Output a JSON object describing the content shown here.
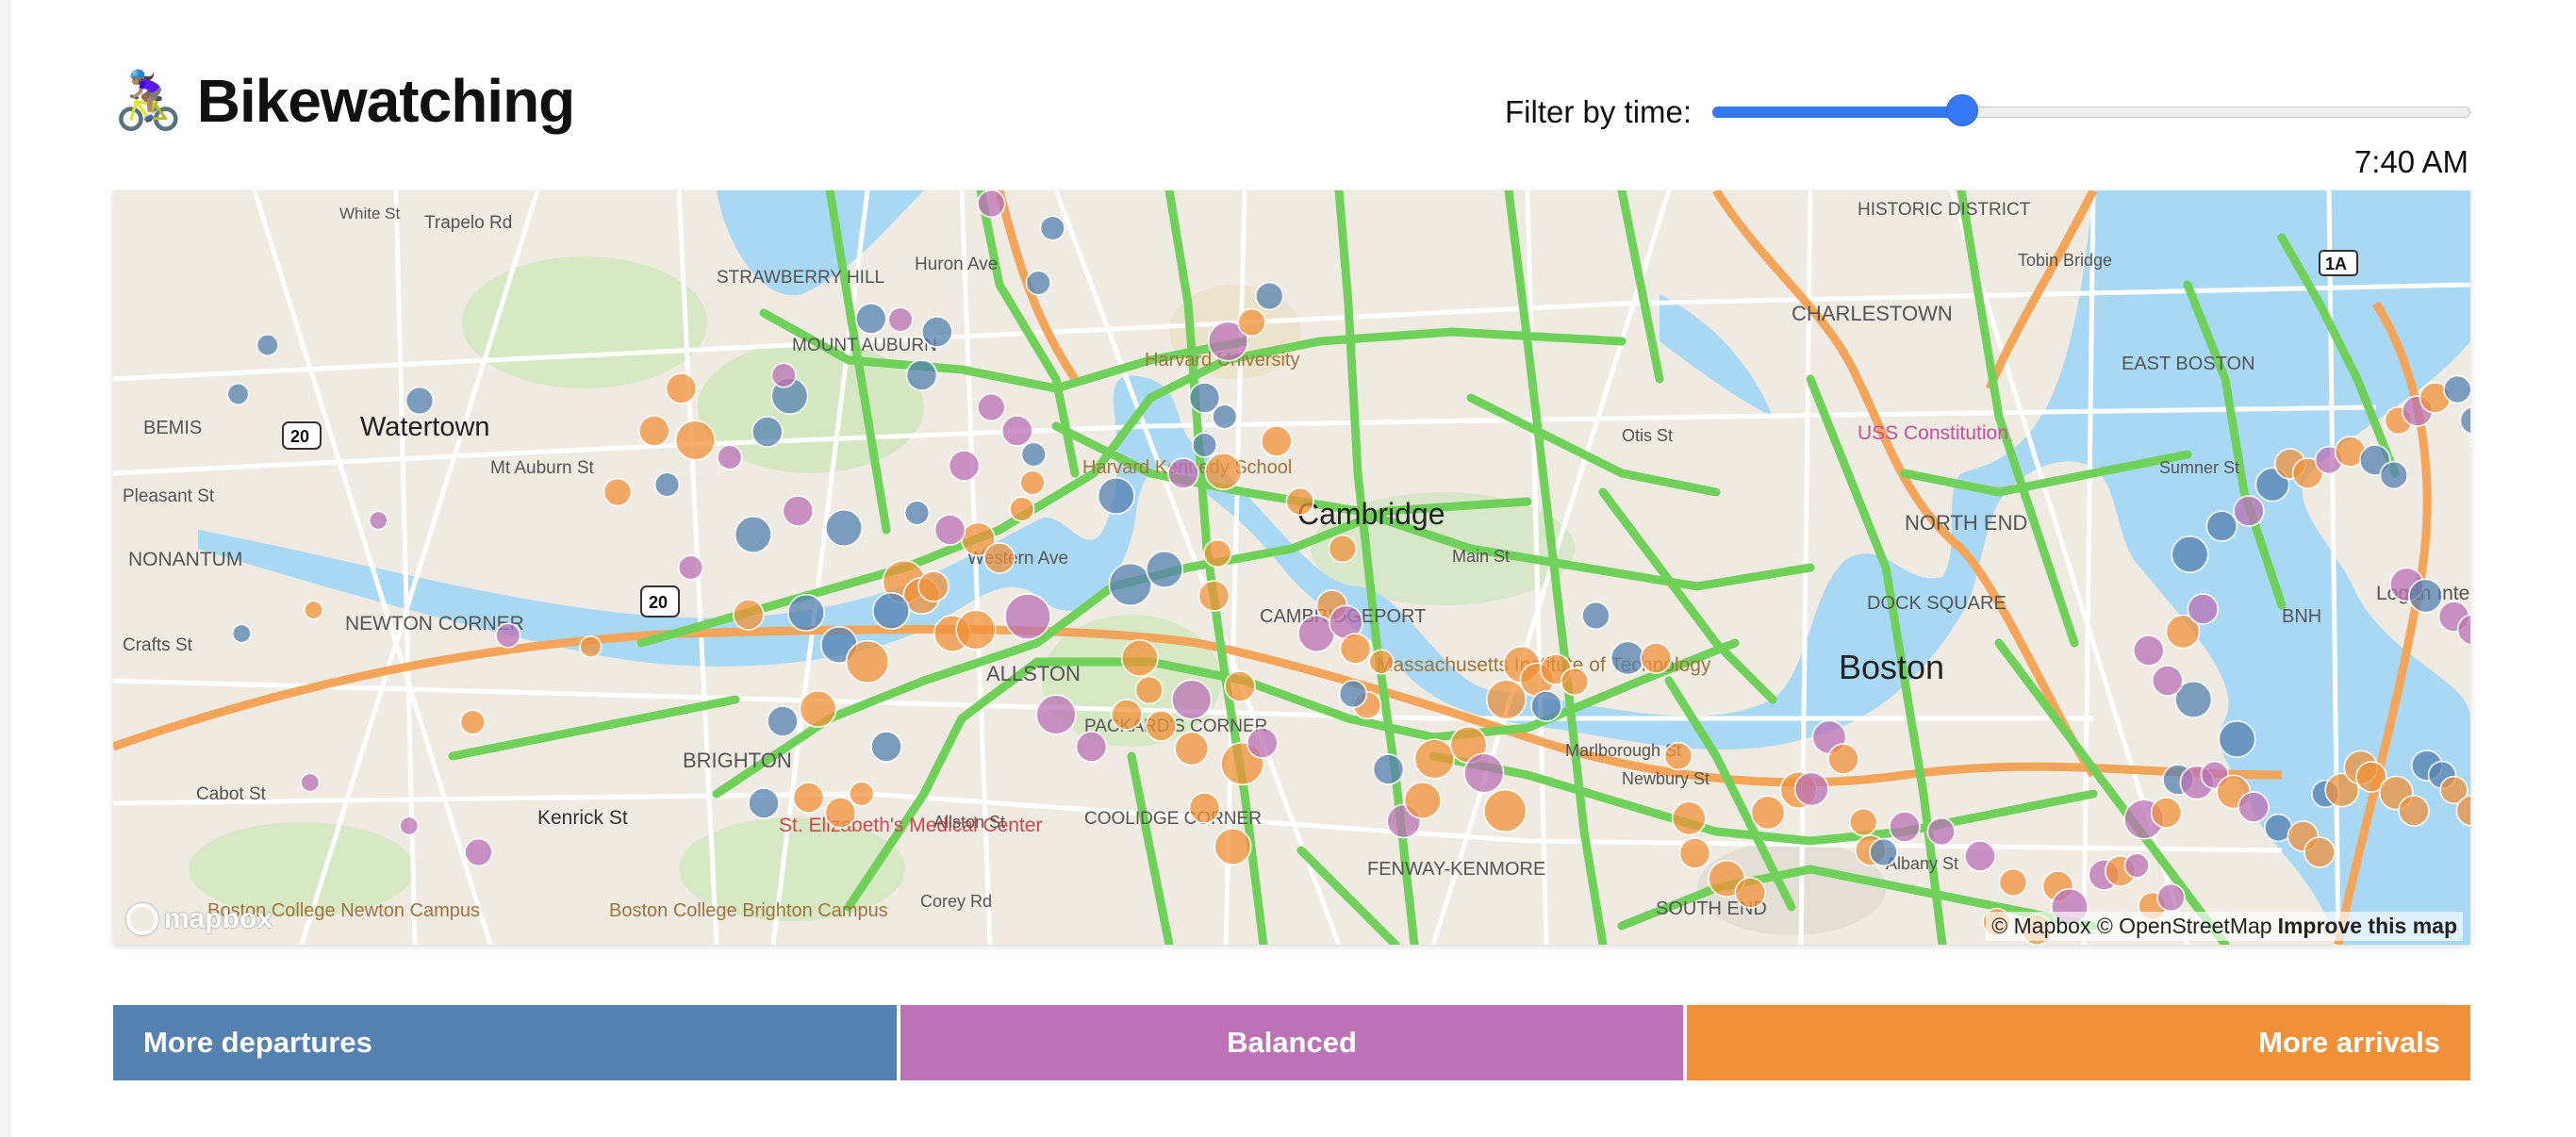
{
  "header": {
    "emoji": "🚴🏽‍♀️",
    "title": "Bikewatching"
  },
  "filter": {
    "label": "Filter by time:",
    "value_fraction": 0.33,
    "time_display": "7:40 AM"
  },
  "colors": {
    "departures": "#5581b0",
    "balanced": "#bb72b6",
    "arrivals": "#f0913a",
    "bike_lanes": "#6fd15a",
    "water": "#a8d8f3",
    "highway": "#f5a55a",
    "slider": "#3478f6"
  },
  "map": {
    "labels": [
      "Watertown",
      "BEMIS",
      "NONANTUM",
      "NEWTON CORNER",
      "Pleasant St",
      "Mt Auburn St",
      "Crafts St",
      "Cabot St",
      "Kenrick St",
      "BRIGHTON",
      "St. Elizabeth's Medical Center",
      "ALLSTON",
      "Western Ave",
      "PACKARD'S CORNER",
      "COOLIDGE CORNER",
      "FENWAY-KENMORE",
      "SOUTH END",
      "Cambridge",
      "CAMBRIDGEPORT",
      "Massachusetts Institute of Technology",
      "Harvard University",
      "Harvard Kennedy School",
      "STRAWBERRY HILL",
      "MOUNT AUBURN",
      "Huron Ave",
      "Trapelo Rd",
      "White St",
      "HISTORIC DISTRICT",
      "CHARLESTOWN",
      "EAST BOSTON",
      "USS Constitution",
      "NORTH END",
      "DOCK SQUARE",
      "Boston",
      "Logan International Airport",
      "BNH",
      "Marlborough St",
      "Newbury St",
      "Albany St",
      "Allston St",
      "Corey Rd",
      "Boston College Brighton Campus",
      "Boston College Newton Campus",
      "Tobin Bridge",
      "Sumner St",
      "Otis St",
      "Main St"
    ],
    "shields": [
      "20",
      "20",
      "1A"
    ],
    "attribution": "© Mapbox © OpenStreetMap",
    "improve_link": "Improve this map",
    "logo": "mapbox"
  },
  "stations": [
    [
      "d",
      0.106,
      0.216,
      7
    ],
    [
      "d",
      0.131,
      0.164,
      7
    ],
    [
      "d",
      0.26,
      0.223,
      9
    ],
    [
      "b",
      0.225,
      0.35,
      6
    ],
    [
      "o",
      0.17,
      0.445,
      6
    ],
    [
      "d",
      0.109,
      0.47,
      6
    ],
    [
      "b",
      0.167,
      0.628,
      6
    ],
    [
      "b",
      0.251,
      0.674,
      6
    ],
    [
      "o",
      0.305,
      0.564,
      8
    ],
    [
      "b",
      0.335,
      0.472,
      8
    ],
    [
      "b",
      0.31,
      0.702,
      9
    ],
    [
      "o",
      0.405,
      0.484,
      7
    ],
    [
      "o",
      0.428,
      0.32,
      9
    ],
    [
      "o",
      0.459,
      0.255,
      10
    ],
    [
      "o",
      0.482,
      0.21,
      10
    ],
    [
      "o",
      0.494,
      0.265,
      13
    ],
    [
      "b",
      0.49,
      0.4,
      8
    ],
    [
      "d",
      0.47,
      0.312,
      8
    ],
    [
      "d",
      0.574,
      0.218,
      12
    ],
    [
      "b",
      0.569,
      0.196,
      8
    ],
    [
      "d",
      0.543,
      0.365,
      12
    ],
    [
      "d",
      0.555,
      0.256,
      10
    ],
    [
      "b",
      0.523,
      0.283,
      8
    ],
    [
      "o",
      0.539,
      0.45,
      10
    ],
    [
      "b",
      0.581,
      0.34,
      10
    ],
    [
      "d",
      0.616,
      0.482,
      12
    ],
    [
      "o",
      0.598,
      0.55,
      12
    ],
    [
      "o",
      0.64,
      0.5,
      14
    ],
    [
      "o",
      0.671,
      0.415,
      14
    ],
    [
      "o",
      0.686,
      0.43,
      12
    ],
    [
      "o",
      0.712,
      0.47,
      12
    ],
    [
      "o",
      0.732,
      0.466,
      13
    ],
    [
      "o",
      0.734,
      0.37,
      11
    ],
    [
      "b",
      0.71,
      0.36,
      10
    ],
    [
      "d",
      0.682,
      0.342,
      8
    ],
    [
      "d",
      0.66,
      0.446,
      12
    ],
    [
      "d",
      0.62,
      0.358,
      12
    ],
    [
      "d",
      0.588,
      0.448,
      12
    ],
    [
      "d",
      0.568,
      0.563,
      10
    ],
    [
      "d",
      0.552,
      0.65,
      10
    ],
    [
      "o",
      0.59,
      0.644,
      10
    ],
    [
      "o",
      0.617,
      0.66,
      10
    ],
    [
      "o",
      0.635,
      0.64,
      8
    ],
    [
      "d",
      0.656,
      0.59,
      10
    ],
    [
      "o",
      0.696,
      0.42,
      10
    ],
    [
      "o",
      0.752,
      0.39,
      10
    ],
    [
      "o",
      0.771,
      0.338,
      8
    ],
    [
      "o",
      0.78,
      0.31,
      8
    ],
    [
      "b",
      0.767,
      0.255,
      10
    ],
    [
      "d",
      0.781,
      0.28,
      8
    ],
    [
      "d",
      0.686,
      0.196,
      10
    ],
    [
      "d",
      0.699,
      0.15,
      10
    ],
    [
      "d",
      0.643,
      0.136,
      10
    ],
    [
      "b",
      0.668,
      0.137,
      8
    ],
    [
      "b",
      0.745,
      0.014,
      9
    ],
    [
      "d",
      0.785,
      0.098,
      8
    ],
    [
      "d",
      0.797,
      0.04,
      8
    ],
    [
      "b",
      0.722,
      0.292,
      10
    ],
    [
      "b",
      0.745,
      0.23,
      9
    ],
    [
      "b",
      0.776,
      0.452,
      15
    ],
    [
      "b",
      0.8,
      0.556,
      13
    ],
    [
      "b",
      0.83,
      0.59,
      10
    ],
    [
      "o",
      0.86,
      0.556,
      10
    ],
    [
      "o",
      0.889,
      0.568,
      10
    ],
    [
      "o",
      0.871,
      0.496,
      12
    ],
    [
      "o",
      0.879,
      0.53,
      9
    ],
    [
      "d",
      0.863,
      0.418,
      14
    ],
    [
      "d",
      0.851,
      0.324,
      12
    ],
    [
      "d",
      0.892,
      0.402,
      12
    ],
    [
      "b",
      0.915,
      0.54,
      13
    ],
    [
      "o",
      0.915,
      0.592,
      11
    ],
    [
      "o",
      0.926,
      0.655,
      10
    ],
    [
      "o",
      0.95,
      0.696,
      12
    ],
    [
      "o",
      0.958,
      0.608,
      14
    ],
    [
      "b",
      0.975,
      0.586,
      10
    ],
    [
      "o",
      0.956,
      0.526,
      10
    ],
    [
      "o",
      0.934,
      0.43,
      10
    ],
    [
      "o",
      0.937,
      0.385,
      9
    ],
    [
      "o",
      0.942,
      0.298,
      12
    ],
    [
      "d",
      0.926,
      0.27,
      8
    ],
    [
      "b",
      0.946,
      0.16,
      13
    ],
    [
      "o",
      0.966,
      0.14,
      9
    ],
    [
      "d",
      0.981,
      0.112,
      9
    ],
    [
      "d",
      0.926,
      0.22,
      10
    ],
    [
      "b",
      0.908,
      0.3,
      10
    ],
    [
      "d",
      0.943,
      0.24,
      8
    ],
    [
      "o",
      0.987,
      0.266,
      10
    ],
    [
      "o",
      1.007,
      0.33,
      9
    ],
    [
      "o",
      1.043,
      0.38,
      9
    ],
    [
      "o",
      1.034,
      0.44,
      10
    ],
    [
      "b",
      1.021,
      0.47,
      12
    ],
    [
      "b",
      1.046,
      0.458,
      11
    ],
    [
      "o",
      1.054,
      0.486,
      10
    ],
    [
      "o",
      1.076,
      0.5,
      8
    ],
    [
      "o",
      1.064,
      0.546,
      9
    ],
    [
      "d",
      1.052,
      0.534,
      9
    ],
    [
      "d",
      1.082,
      0.614,
      10
    ],
    [
      "b",
      1.095,
      0.669,
      11
    ],
    [
      "o",
      1.111,
      0.647,
      12
    ],
    [
      "o",
      1.121,
      0.603,
      13
    ],
    [
      "o",
      1.15,
      0.588,
      12
    ],
    [
      "b",
      1.163,
      0.618,
      13
    ],
    [
      "o",
      1.181,
      0.658,
      14
    ],
    [
      "o",
      1.182,
      0.54,
      13
    ],
    [
      "o",
      1.195,
      0.503,
      12
    ],
    [
      "o",
      1.208,
      0.519,
      11
    ],
    [
      "d",
      1.216,
      0.547,
      10
    ],
    [
      "o",
      1.224,
      0.508,
      10
    ],
    [
      "o",
      1.24,
      0.521,
      9
    ],
    [
      "d",
      1.258,
      0.451,
      9
    ],
    [
      "d",
      1.285,
      0.496,
      11
    ],
    [
      "o",
      1.309,
      0.496,
      10
    ],
    [
      "o",
      1.328,
      0.6,
      9
    ],
    [
      "o",
      1.337,
      0.666,
      11
    ],
    [
      "o",
      1.342,
      0.703,
      10
    ],
    [
      "o",
      1.369,
      0.73,
      12
    ],
    [
      "o",
      1.389,
      0.745,
      10
    ],
    [
      "o",
      1.404,
      0.66,
      11
    ],
    [
      "o",
      1.43,
      0.636,
      12
    ],
    [
      "b",
      1.441,
      0.635,
      11
    ],
    [
      "b",
      1.456,
      0.58,
      11
    ],
    [
      "o",
      1.468,
      0.603,
      10
    ],
    [
      "o",
      1.485,
      0.67,
      9
    ],
    [
      "o",
      1.491,
      0.7,
      10
    ],
    [
      "d",
      1.502,
      0.702,
      9
    ],
    [
      "b",
      1.52,
      0.675,
      10
    ],
    [
      "b",
      1.551,
      0.68,
      9
    ],
    [
      "b",
      1.584,
      0.706,
      10
    ],
    [
      "o",
      1.598,
      0.776,
      9
    ],
    [
      "o",
      1.612,
      0.734,
      9
    ],
    [
      "o",
      1.632,
      0.784,
      10
    ],
    [
      "o",
      1.65,
      0.738,
      10
    ],
    [
      "b",
      1.66,
      0.76,
      12
    ],
    [
      "b",
      1.689,
      0.726,
      10
    ],
    [
      "o",
      1.703,
      0.722,
      10
    ],
    [
      "b",
      1.717,
      0.716,
      8
    ],
    [
      "o",
      1.73,
      0.759,
      9
    ],
    [
      "b",
      1.746,
      0.75,
      9
    ],
    [
      "b",
      1.723,
      0.667,
      13
    ],
    [
      "o",
      1.742,
      0.66,
      10
    ],
    [
      "d",
      1.752,
      0.625,
      10
    ],
    [
      "b",
      1.768,
      0.628,
      11
    ],
    [
      "b",
      1.783,
      0.62,
      9
    ],
    [
      "o",
      1.799,
      0.638,
      11
    ],
    [
      "b",
      1.816,
      0.654,
      10
    ],
    [
      "d",
      1.837,
      0.676,
      9
    ],
    [
      "o",
      1.858,
      0.685,
      10
    ],
    [
      "o",
      1.872,
      0.702,
      10
    ],
    [
      "d",
      1.877,
      0.64,
      9
    ],
    [
      "o",
      1.891,
      0.636,
      11
    ],
    [
      "o",
      1.907,
      0.612,
      11
    ],
    [
      "o",
      1.916,
      0.622,
      10
    ],
    [
      "o",
      1.937,
      0.639,
      11
    ],
    [
      "o",
      1.952,
      0.658,
      10
    ],
    [
      "d",
      1.963,
      0.61,
      10
    ],
    [
      "d",
      1.976,
      0.62,
      9
    ],
    [
      "o",
      1.986,
      0.636,
      9
    ],
    [
      "o",
      2.001,
      0.658,
      10
    ],
    [
      "d",
      1.802,
      0.582,
      12
    ],
    [
      "d",
      1.765,
      0.54,
      12
    ],
    [
      "b",
      1.743,
      0.52,
      10
    ],
    [
      "b",
      1.727,
      0.488,
      10
    ],
    [
      "o",
      1.756,
      0.468,
      11
    ],
    [
      "b",
      1.773,
      0.444,
      10
    ],
    [
      "d",
      1.762,
      0.386,
      12
    ],
    [
      "d",
      1.789,
      0.356,
      10
    ],
    [
      "b",
      1.812,
      0.34,
      10
    ],
    [
      "d",
      1.832,
      0.312,
      11
    ],
    [
      "o",
      1.847,
      0.29,
      10
    ],
    [
      "o",
      1.862,
      0.3,
      10
    ],
    [
      "b",
      1.88,
      0.286,
      9
    ],
    [
      "o",
      1.898,
      0.277,
      10
    ],
    [
      "d",
      1.919,
      0.286,
      10
    ],
    [
      "d",
      1.935,
      0.302,
      9
    ],
    [
      "o",
      1.939,
      0.244,
      9
    ],
    [
      "b",
      1.955,
      0.234,
      10
    ],
    [
      "o",
      1.97,
      0.22,
      10
    ],
    [
      "d",
      1.989,
      0.211,
      9
    ],
    [
      "d",
      2.003,
      0.244,
      9
    ],
    [
      "b",
      2.012,
      0.265,
      10
    ],
    [
      "d",
      2.027,
      0.262,
      9
    ],
    [
      "o",
      2.038,
      0.226,
      10
    ],
    [
      "b",
      2.054,
      0.236,
      9
    ],
    [
      "b",
      1.946,
      0.418,
      11
    ],
    [
      "d",
      1.962,
      0.43,
      11
    ],
    [
      "b",
      1.986,
      0.452,
      10
    ],
    [
      "b",
      2.002,
      0.466,
      10
    ],
    [
      "d",
      2.017,
      0.47,
      9
    ],
    [
      "o",
      2.03,
      0.484,
      9
    ],
    [
      "o",
      2.046,
      0.494,
      10
    ],
    [
      "o",
      2.06,
      0.503,
      9
    ],
    [
      "b",
      2.075,
      0.52,
      9
    ],
    [
      "o",
      2.091,
      0.532,
      10
    ],
    [
      "o",
      2.104,
      0.528,
      10
    ],
    [
      "b",
      2.121,
      0.541,
      10
    ],
    [
      "d",
      2.138,
      0.553,
      9
    ],
    [
      "o",
      2.153,
      0.56,
      9
    ],
    [
      "o",
      2.17,
      0.569,
      10
    ],
    [
      "b",
      2.186,
      0.571,
      9
    ],
    [
      "d",
      2.201,
      0.58,
      9
    ],
    [
      "o",
      2.218,
      0.592,
      10
    ],
    [
      "o",
      2.236,
      0.599,
      10
    ],
    [
      "b",
      2.252,
      0.61,
      9
    ],
    [
      "d",
      2.268,
      0.616,
      10
    ],
    [
      "o",
      2.283,
      0.625,
      9
    ],
    [
      "o",
      2.3,
      0.631,
      10
    ],
    [
      "b",
      2.318,
      0.64,
      9
    ],
    [
      "d",
      2.334,
      0.65,
      9
    ],
    [
      "o",
      2.35,
      0.657,
      10
    ],
    [
      "o",
      2.367,
      0.661,
      10
    ],
    [
      "b",
      2.384,
      0.672,
      10
    ],
    [
      "d",
      2.4,
      0.68,
      9
    ],
    [
      "o",
      2.416,
      0.69,
      9
    ],
    [
      "o",
      2.433,
      0.695,
      9
    ],
    [
      "b",
      2.45,
      0.701,
      9
    ]
  ]
}
